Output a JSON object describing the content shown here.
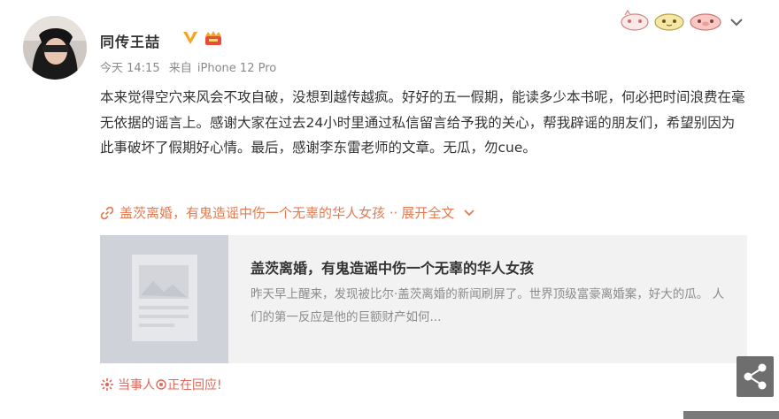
{
  "author": {
    "name": "同传王喆"
  },
  "meta": {
    "time": "今天 14:15",
    "source_prefix": "来自",
    "device": "iPhone 12 Pro"
  },
  "post": {
    "text": "本来觉得空穴来风会不攻自破，没想到越传越疯。好好的五一假期，能读多少本书呢，何必把时间浪费在毫无依据的谣言上。感谢大家在过去24小时里通过私信留言给予我的关心，帮我辟谣的朋友们，希望别因为此事破坏了假期好心情。最后，感谢李东雷老师的文章。无瓜，勿cue。",
    "link_text": "盖茨离婚，有鬼造谣中伤一个无辜的华人女孩",
    "expand_label": "展开全文"
  },
  "card": {
    "title": "盖茨离婚，有鬼造谣中伤一个无辜的华人女孩",
    "summary": "昨天早上醒来，发现被比尔·盖茨离婚的新闻刷屏了。世界顶级富豪离婚案，好大的瓜。 人们的第一反应是他的巨额财产如何..."
  },
  "event": {
    "label": "当事人",
    "status": "正在回应!"
  },
  "colors": {
    "link": "#e07b53",
    "event": "#e0685c",
    "vip": "#f6a623",
    "card_bg": "#f2f2f2"
  },
  "icons": [
    "vip-icon",
    "member-badge-icon",
    "sticker-icon",
    "chevron-down-icon",
    "link-icon",
    "burst-icon",
    "share-icon"
  ]
}
